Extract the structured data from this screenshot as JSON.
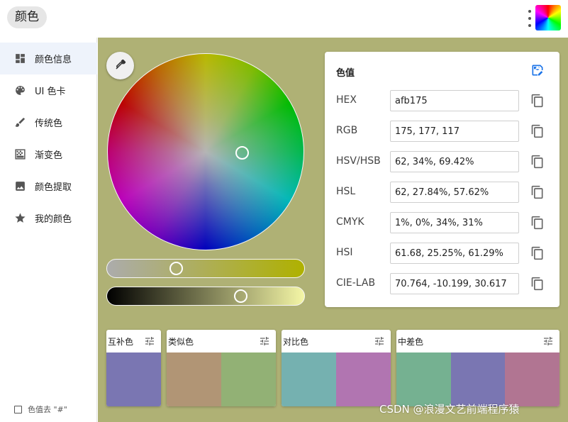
{
  "header": {
    "title": "颜色"
  },
  "sidebar": {
    "items": [
      {
        "label": "颜色信息",
        "icon": "dashboard-icon",
        "active": true
      },
      {
        "label": "UI 色卡",
        "icon": "palette-icon",
        "active": false
      },
      {
        "label": "传统色",
        "icon": "brush-icon",
        "active": false
      },
      {
        "label": "渐变色",
        "icon": "gradient-icon",
        "active": false
      },
      {
        "label": "颜色提取",
        "icon": "image-icon",
        "active": false
      },
      {
        "label": "我的颜色",
        "icon": "star-icon",
        "active": false
      }
    ],
    "option_label": "色值去 \"#\"",
    "option_checked": false
  },
  "current_color": "#afb175",
  "sliders": {
    "saturation_percent": 34,
    "value_percent": 69.42
  },
  "values_card": {
    "title": "色值",
    "rows": [
      {
        "label": "HEX",
        "value": "afb175"
      },
      {
        "label": "RGB",
        "value": "175, 177, 117"
      },
      {
        "label": "HSV/HSB",
        "value": "62, 34%, 69.42%"
      },
      {
        "label": "HSL",
        "value": "62, 27.84%, 57.62%"
      },
      {
        "label": "CMYK",
        "value": "1%, 0%, 34%, 31%"
      },
      {
        "label": "HSI",
        "value": "61.68, 25.25%, 61.29%"
      },
      {
        "label": "CIE-LAB",
        "value": "70.764, -10.199, 30.617"
      }
    ]
  },
  "palettes": [
    {
      "title": "互补色",
      "colors": [
        "#7a76b2"
      ]
    },
    {
      "title": "类似色",
      "colors": [
        "#b19575",
        "#92b175"
      ]
    },
    {
      "title": "对比色",
      "colors": [
        "#75b1b0",
        "#b175b1"
      ]
    },
    {
      "title": "中差色",
      "colors": [
        "#75b191",
        "#7a76b2",
        "#b17592"
      ]
    }
  ],
  "watermark": "CSDN @浪漫文艺前端程序猿"
}
